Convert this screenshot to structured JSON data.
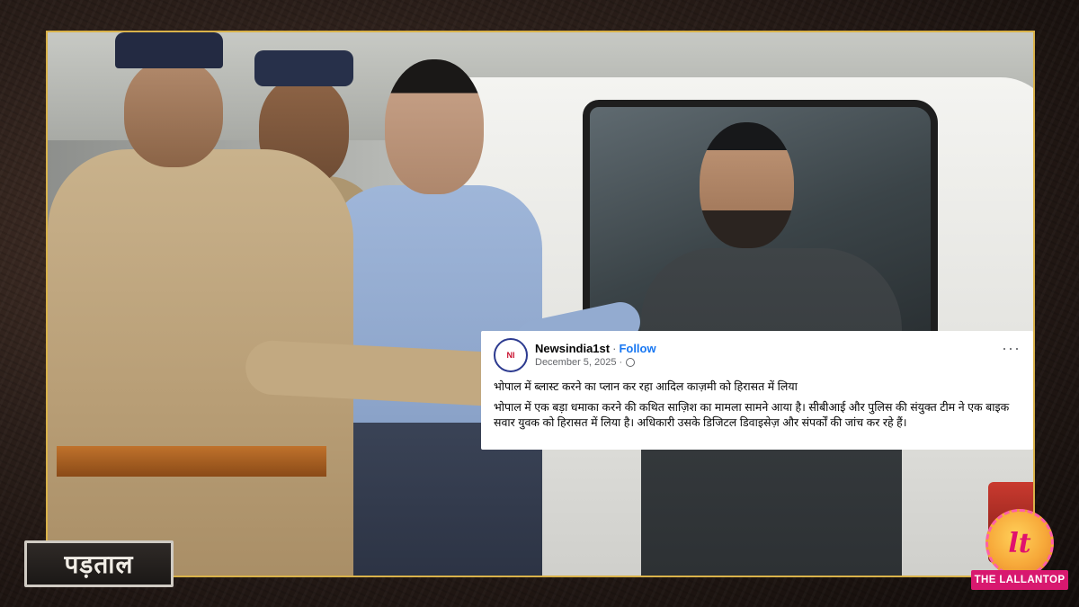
{
  "post": {
    "author": "Newsindia1st",
    "separator": "·",
    "follow_label": "Follow",
    "date": "December 5, 2025 ·",
    "more_label": "···",
    "avatar_text": "NI",
    "headline": "भोपाल में ब्लास्ट करने का प्लान कर रहा आदिल काज़मी को हिरासत में लिया",
    "body": "भोपाल में एक बड़ा धमाका करने की कथित साज़िश का मामला सामने आया है। सीबीआई और पुलिस की संयुक्त टीम ने एक बाइक सवार युवक को हिरासत में लिया है। अधिकारी उसके डिजिटल डिवाइसेज़ और संपर्कों की जांच कर रहे हैं।"
  },
  "badge": {
    "label": "पड़ताल"
  },
  "logo": {
    "monogram": "lt",
    "name": "THE LALLANTOP"
  },
  "colors": {
    "frame_border": "#d9b24a",
    "follow_link": "#1877f2",
    "logo_pink": "#d8186f"
  }
}
